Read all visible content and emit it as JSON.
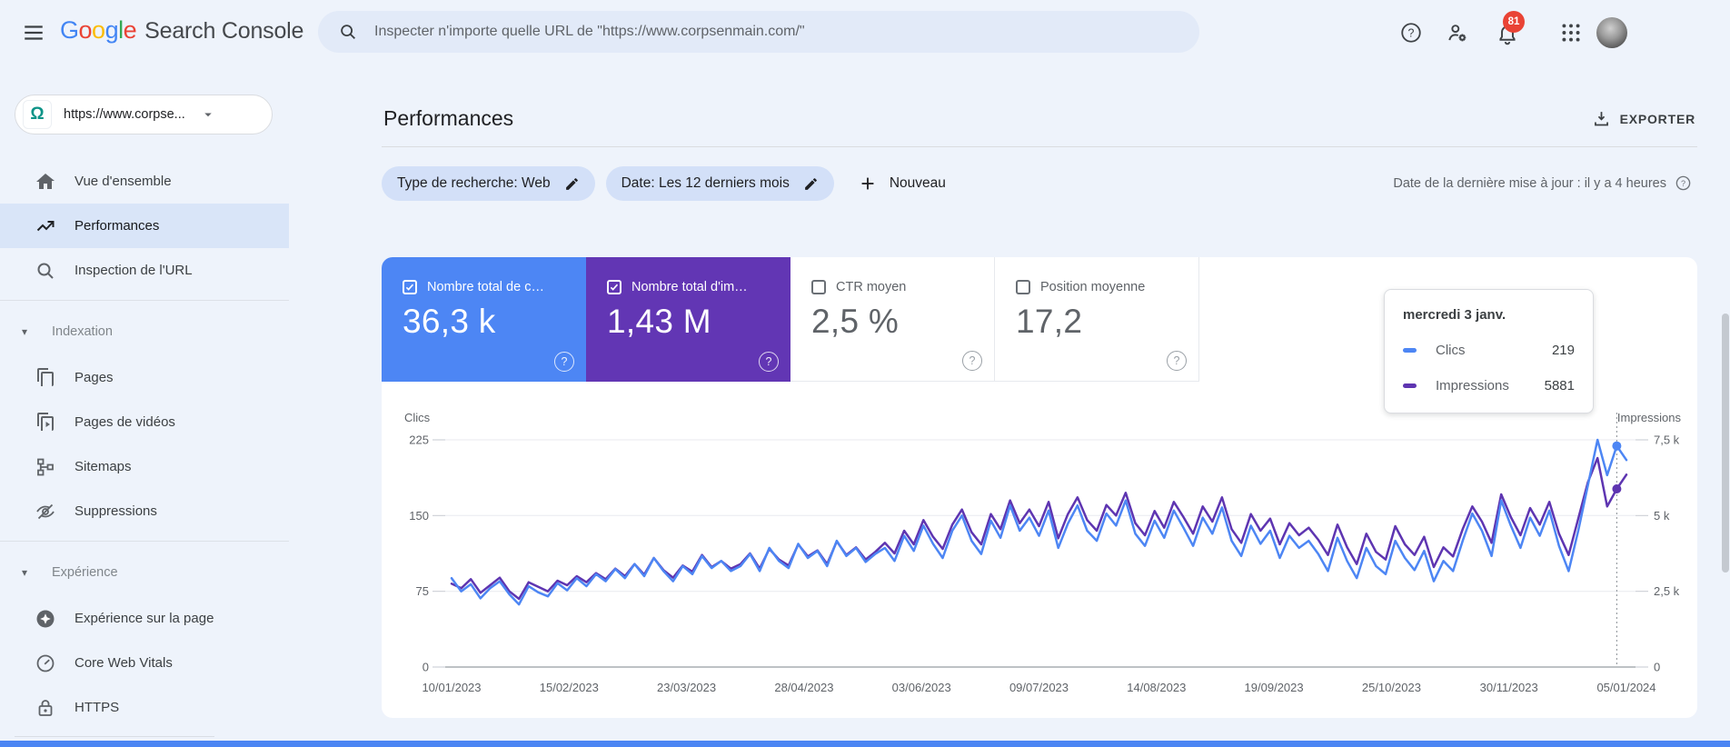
{
  "topbar": {
    "logo_letters": [
      [
        "G",
        "#4285F4"
      ],
      [
        "o",
        "#EA4335"
      ],
      [
        "o",
        "#FBBC05"
      ],
      [
        "g",
        "#4285F4"
      ],
      [
        "l",
        "#34A853"
      ],
      [
        "e",
        "#EA4335"
      ]
    ],
    "logo_suffix": "Search Console",
    "search_placeholder": "Inspecter n'importe quelle URL de \"https://www.corpsenmain.com/\"",
    "notification_count": "81"
  },
  "sidebar": {
    "property_label": "https://www.corpse...",
    "groups": [
      {
        "items": [
          {
            "icon": "home",
            "label": "Vue d'ensemble",
            "selected": false
          },
          {
            "icon": "performance",
            "label": "Performances",
            "selected": true
          },
          {
            "icon": "search",
            "label": "Inspection de l'URL",
            "selected": false
          }
        ]
      },
      {
        "section": "Indexation",
        "items": [
          {
            "icon": "pages",
            "label": "Pages",
            "selected": false
          },
          {
            "icon": "video",
            "label": "Pages de vidéos",
            "selected": false
          },
          {
            "icon": "sitemap",
            "label": "Sitemaps",
            "selected": false
          },
          {
            "icon": "removals",
            "label": "Suppressions",
            "selected": false
          }
        ]
      },
      {
        "section": "Expérience",
        "items": [
          {
            "icon": "page-experience",
            "label": "Expérience sur la page",
            "selected": false
          },
          {
            "icon": "core-web-vitals",
            "label": "Core Web Vitals",
            "selected": false
          },
          {
            "icon": "https",
            "label": "HTTPS",
            "selected": false
          }
        ]
      }
    ]
  },
  "header": {
    "title": "Performances",
    "export_label": "EXPORTER",
    "filters": [
      "Type de recherche: Web",
      "Date: Les 12 derniers mois"
    ],
    "new_label": "Nouveau",
    "last_update": "Date de la dernière mise à jour : il y a 4 heures"
  },
  "metrics": [
    {
      "label": "Nombre total de c…",
      "value": "36,3 k",
      "checked": true,
      "bg": "#4d86f4"
    },
    {
      "label": "Nombre total d'im…",
      "value": "1,43 M",
      "checked": true,
      "bg": "#6236b4"
    },
    {
      "label": "CTR moyen",
      "value": "2,5 %",
      "checked": false,
      "bg": "#ffffff"
    },
    {
      "label": "Position moyenne",
      "value": "17,2",
      "checked": false,
      "bg": "#ffffff"
    }
  ],
  "tooltip": {
    "date": "mercredi 3 janv.",
    "rows": [
      {
        "label": "Clics",
        "value": "219",
        "color": "#4d86f4"
      },
      {
        "label": "Impressions",
        "value": "5881",
        "color": "#5e35b1"
      }
    ]
  },
  "chart_data": {
    "type": "line",
    "ylabel_left": "Clics",
    "ylabel_right": "Impressions",
    "ylim_left": [
      0,
      225
    ],
    "ylim_right": [
      0,
      7500
    ],
    "yticks_left": {
      "values": [
        225,
        150,
        75,
        0
      ],
      "labels": [
        "225",
        "150",
        "75",
        "0"
      ]
    },
    "yticks_right": {
      "values": [
        7500,
        5000,
        2500,
        0
      ],
      "labels": [
        "7,5 k",
        "5 k",
        "2,5 k",
        "0"
      ]
    },
    "x_labels": [
      "10/01/2023",
      "15/02/2023",
      "23/03/2023",
      "28/04/2023",
      "03/06/2023",
      "09/07/2023",
      "14/08/2023",
      "19/09/2023",
      "25/10/2023",
      "30/11/2023",
      "05/01/2024"
    ],
    "grid": true,
    "legend_position": "tooltip",
    "series": [
      {
        "name": "Clics",
        "axis": "left",
        "color": "#4d86f4",
        "values": [
          88,
          75,
          82,
          68,
          78,
          85,
          72,
          62,
          80,
          74,
          70,
          83,
          76,
          88,
          80,
          92,
          85,
          97,
          88,
          102,
          90,
          108,
          95,
          85,
          100,
          92,
          110,
          98,
          105,
          95,
          100,
          112,
          95,
          118,
          105,
          98,
          122,
          108,
          115,
          100,
          125,
          110,
          118,
          104,
          112,
          118,
          105,
          130,
          115,
          140,
          122,
          108,
          135,
          150,
          125,
          112,
          145,
          128,
          160,
          135,
          148,
          130,
          155,
          118,
          142,
          160,
          135,
          125,
          152,
          140,
          165,
          132,
          120,
          145,
          128,
          155,
          138,
          120,
          148,
          132,
          158,
          125,
          110,
          140,
          122,
          135,
          108,
          130,
          118,
          125,
          112,
          95,
          128,
          105,
          88,
          118,
          100,
          92,
          125,
          108,
          96,
          115,
          85,
          105,
          95,
          125,
          152,
          135,
          110,
          165,
          140,
          118,
          148,
          130,
          155,
          120,
          95,
          135,
          180,
          225,
          190,
          219,
          205
        ]
      },
      {
        "name": "Impressions",
        "axis": "right",
        "color": "#5e35b1",
        "values": [
          2750,
          2600,
          2900,
          2450,
          2700,
          2950,
          2500,
          2250,
          2800,
          2650,
          2500,
          2850,
          2700,
          3000,
          2800,
          3100,
          2900,
          3250,
          3000,
          3400,
          3050,
          3600,
          3200,
          2950,
          3350,
          3150,
          3700,
          3300,
          3500,
          3250,
          3400,
          3750,
          3250,
          3900,
          3550,
          3350,
          4050,
          3650,
          3850,
          3400,
          4150,
          3700,
          3950,
          3550,
          3800,
          4100,
          3750,
          4500,
          4050,
          4850,
          4300,
          3900,
          4700,
          5200,
          4450,
          4050,
          5050,
          4550,
          5500,
          4750,
          5200,
          4650,
          5450,
          4250,
          5050,
          5600,
          4850,
          4500,
          5350,
          5000,
          5750,
          4750,
          4350,
          5150,
          4600,
          5450,
          4950,
          4400,
          5300,
          4800,
          5600,
          4550,
          4100,
          5050,
          4500,
          4900,
          4050,
          4750,
          4350,
          4600,
          4200,
          3700,
          4700,
          3950,
          3400,
          4400,
          3800,
          3550,
          4650,
          4050,
          3700,
          4300,
          3300,
          3950,
          3650,
          4550,
          5300,
          4800,
          4100,
          5700,
          4950,
          4350,
          5250,
          4700,
          5450,
          4400,
          3700,
          4900,
          6100,
          6900,
          5300,
          5881,
          6350
        ]
      }
    ],
    "hover": {
      "index": 121,
      "date": "mercredi 3 janv.",
      "clics": 219,
      "impressions": 5881
    }
  }
}
